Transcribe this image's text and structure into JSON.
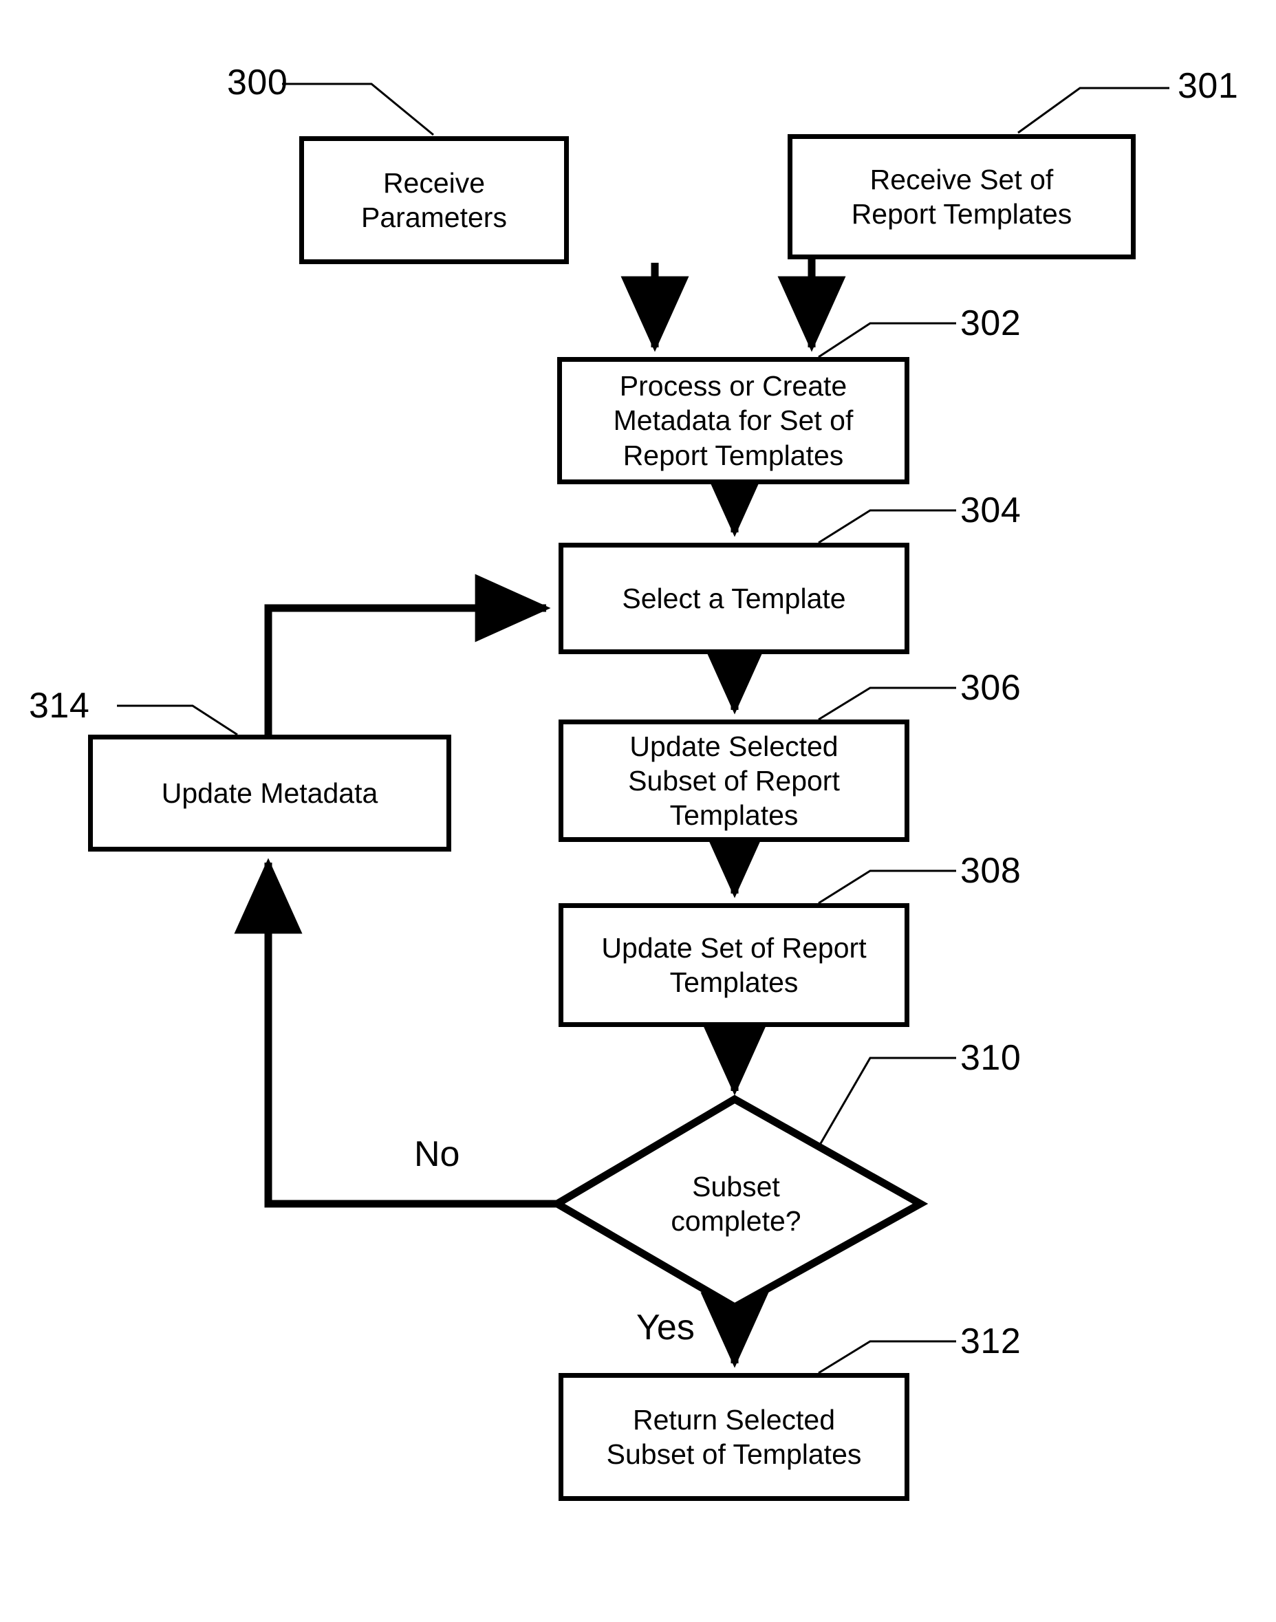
{
  "figure": {
    "type": "flowchart",
    "background_color": "#ffffff",
    "line_color": "#000000"
  },
  "nodes": [
    {
      "id": "300",
      "name": "receive-parameters",
      "shape": "process",
      "text": "Receive Parameters",
      "ref": "300"
    },
    {
      "id": "301",
      "name": "receive-set-of-report-templates",
      "shape": "process",
      "text": "Receive Set of\nReport Templates",
      "ref": "301"
    },
    {
      "id": "302",
      "name": "process-or-create-metadata",
      "shape": "process",
      "text": "Process or Create\nMetadata for Set of\nReport Templates",
      "ref": "302"
    },
    {
      "id": "304",
      "name": "select-a-template",
      "shape": "process",
      "text": "Select a Template",
      "ref": "304"
    },
    {
      "id": "306",
      "name": "update-selected-subset-of-report-templates",
      "shape": "process",
      "text": "Update Selected\nSubset of Report\nTemplates",
      "ref": "306"
    },
    {
      "id": "308",
      "name": "update-set-of-report-templates",
      "shape": "process",
      "text": "Update Set of Report\nTemplates",
      "ref": "308"
    },
    {
      "id": "310",
      "name": "subset-complete-decision",
      "shape": "decision",
      "text": "Subset\ncomplete?",
      "ref": "310"
    },
    {
      "id": "312",
      "name": "return-selected-subset-of-templates",
      "shape": "process",
      "text": "Return Selected\nSubset of Templates",
      "ref": "312"
    },
    {
      "id": "314",
      "name": "update-metadata",
      "shape": "process",
      "text": "Update Metadata",
      "ref": "314"
    }
  ],
  "edge_labels": {
    "no": "No",
    "yes": "Yes"
  },
  "ref_labels": {
    "n300": "300",
    "n301": "301",
    "n302": "302",
    "n304": "304",
    "n306": "306",
    "n308": "308",
    "n310": "310",
    "n312": "312",
    "n314": "314"
  }
}
